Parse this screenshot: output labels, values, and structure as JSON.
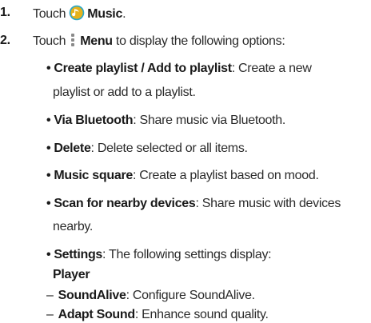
{
  "steps": [
    {
      "number": "1.",
      "prefix": "Touch",
      "icon": "music-app-icon",
      "bold": "Music",
      "suffix": "."
    },
    {
      "number": "2.",
      "prefix": "Touch",
      "icon": "menu-icon",
      "bold": "Menu",
      "suffix": " to display the following options:"
    }
  ],
  "options": [
    {
      "title": "Create playlist / Add to playlist",
      "desc_line1": ": Create a new",
      "desc_line2": "playlist or add to a playlist."
    },
    {
      "title": "Via Bluetooth",
      "desc": ": Share music via Bluetooth."
    },
    {
      "title": "Delete",
      "desc": ": Delete selected or all items."
    },
    {
      "title": "Music square",
      "desc": ": Create a playlist based on mood."
    },
    {
      "title": "Scan for nearby devices",
      "desc_line1": ": Share music with devices",
      "desc_line2": "nearby."
    },
    {
      "title": "Settings",
      "desc": ": The following settings display:"
    }
  ],
  "settings_heading": "Player",
  "sub_options": [
    {
      "title": "SoundAlive",
      "desc": ": Configure SoundAlive."
    },
    {
      "title": "Adapt Sound",
      "desc": ": Enhance sound quality."
    }
  ],
  "bullet_char": "•",
  "dash_char": "–",
  "colors": {
    "text": "#2b2b2b",
    "bold_text": "#1a1a1a",
    "music_icon_fill": "#e5b21b",
    "music_icon_rim": "#2aa7c9",
    "menu_icon": "#8a8a8a"
  }
}
